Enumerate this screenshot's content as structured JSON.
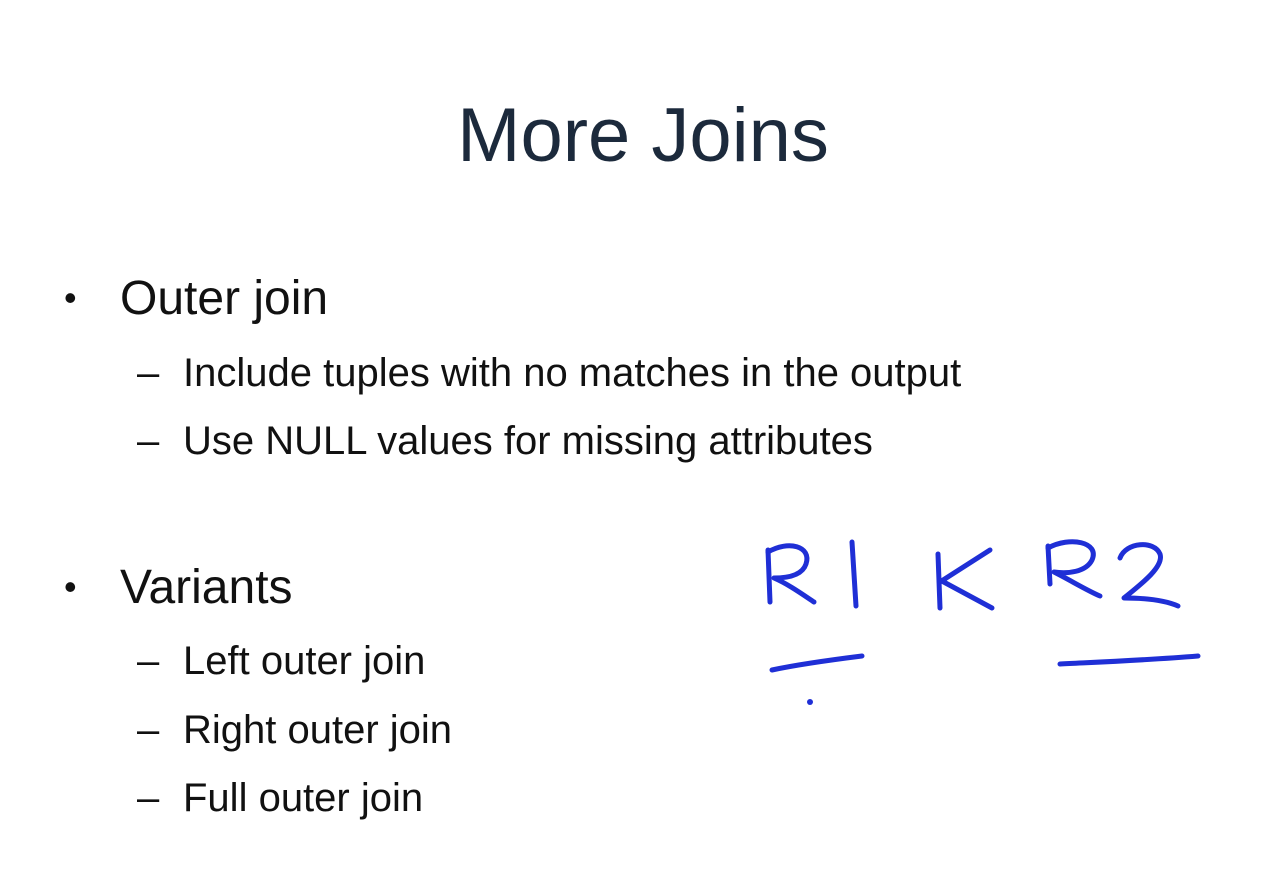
{
  "slide": {
    "title": "More Joins",
    "bullets": [
      {
        "marker": "•",
        "label": "Outer join",
        "subitems": [
          {
            "marker": "–",
            "label": "Include tuples with no matches in the output"
          },
          {
            "marker": "–",
            "label": "Use NULL values for missing attributes"
          }
        ]
      },
      {
        "marker": "•",
        "label": "Variants",
        "subitems": [
          {
            "marker": "–",
            "label": "Left outer join"
          },
          {
            "marker": "–",
            "label": "Right outer join"
          },
          {
            "marker": "–",
            "label": "Full outer join"
          }
        ]
      }
    ]
  },
  "handwriting": {
    "text": "R1 ⟕ R2",
    "ink_color": "#1f2fd6"
  }
}
